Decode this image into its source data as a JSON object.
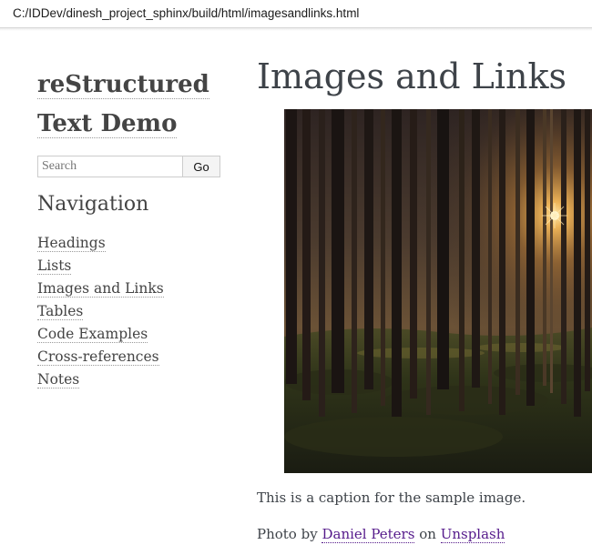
{
  "browser": {
    "url": "C:/IDDev/dinesh_project_sphinx/build/html/imagesandlinks.html"
  },
  "sidebar": {
    "logo_line1": "reStructured",
    "logo_line2": "Text Demo",
    "search": {
      "placeholder": "Search",
      "button_label": "Go"
    },
    "nav_heading": "Navigation",
    "nav_items": [
      {
        "label": "Headings"
      },
      {
        "label": "Lists"
      },
      {
        "label": "Images and Links"
      },
      {
        "label": "Tables"
      },
      {
        "label": "Code Examples"
      },
      {
        "label": "Cross-references"
      },
      {
        "label": "Notes"
      }
    ]
  },
  "main": {
    "title": "Images and Links",
    "caption": "This is a caption for the sample image.",
    "credit": {
      "prefix": "Photo by",
      "author": "Daniel Peters",
      "middle": "on",
      "site": "Unsplash"
    }
  },
  "colors": {
    "text": "#3e4349",
    "visited_link": "#551a8b",
    "sun": "#ffd27a"
  }
}
